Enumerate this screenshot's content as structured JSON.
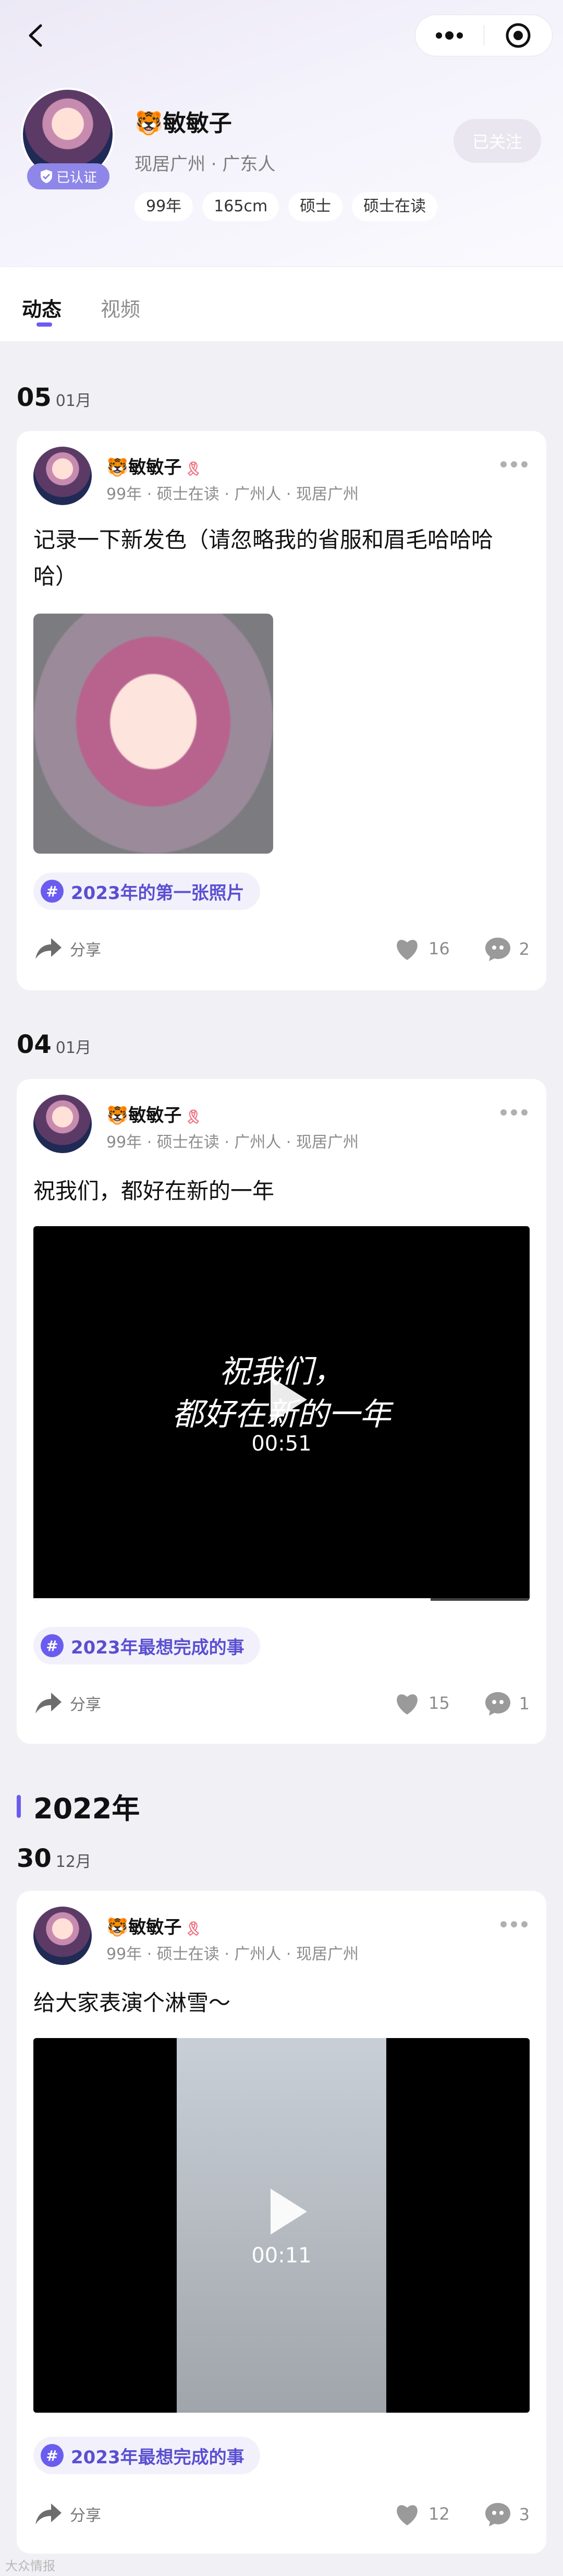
{
  "header": {
    "name": "🐯敏敏子",
    "verified": "已认证",
    "location": "现居广州 · 广东人",
    "tags": [
      "99年",
      "165cm",
      "硕士",
      "硕士在读"
    ],
    "follow_label": "已关注"
  },
  "tabs": [
    "动态",
    "视频"
  ],
  "posts": [
    {
      "date_day": "05",
      "date_month": "01月",
      "author": "🐯敏敏子",
      "badge": "🎗",
      "meta": "99年 · 硕士在读 · 广州人 · 现居广州",
      "text": "记录一下新发色（请忽略我的省服和眉毛哈哈哈哈）",
      "topic": "2023年的第一张照片",
      "share": "分享",
      "likes": "16",
      "comments": "2"
    },
    {
      "date_day": "04",
      "date_month": "01月",
      "author": "🐯敏敏子",
      "badge": "🎗",
      "meta": "99年 · 硕士在读 · 广州人 · 现居广州",
      "text": "祝我们，都好在新的一年",
      "video_caption1": "祝我们，",
      "video_caption2": "都好在新的一年",
      "duration": "00:51",
      "topic": "2023年最想完成的事",
      "share": "分享",
      "likes": "15",
      "comments": "1"
    },
    {
      "year": "2022年",
      "date_day": "30",
      "date_month": "12月",
      "author": "🐯敏敏子",
      "badge": "🎗",
      "meta": "99年 · 硕士在读 · 广州人 · 现居广州",
      "text": "给大家表演个淋雪～",
      "duration": "00:11",
      "topic": "2023年最想完成的事",
      "share": "分享",
      "likes": "12",
      "comments": "3"
    }
  ],
  "icons": {
    "back": "chevron-left-icon",
    "menu": "more-dots-icon",
    "close": "target-icon",
    "share": "share-arrow-icon",
    "like": "heart-icon",
    "comment": "comment-icon"
  },
  "colors": {
    "accent": "#6b5cf0",
    "verified": "#8e86e8",
    "bg": "#f1f1f5"
  },
  "footer": "大众情报"
}
